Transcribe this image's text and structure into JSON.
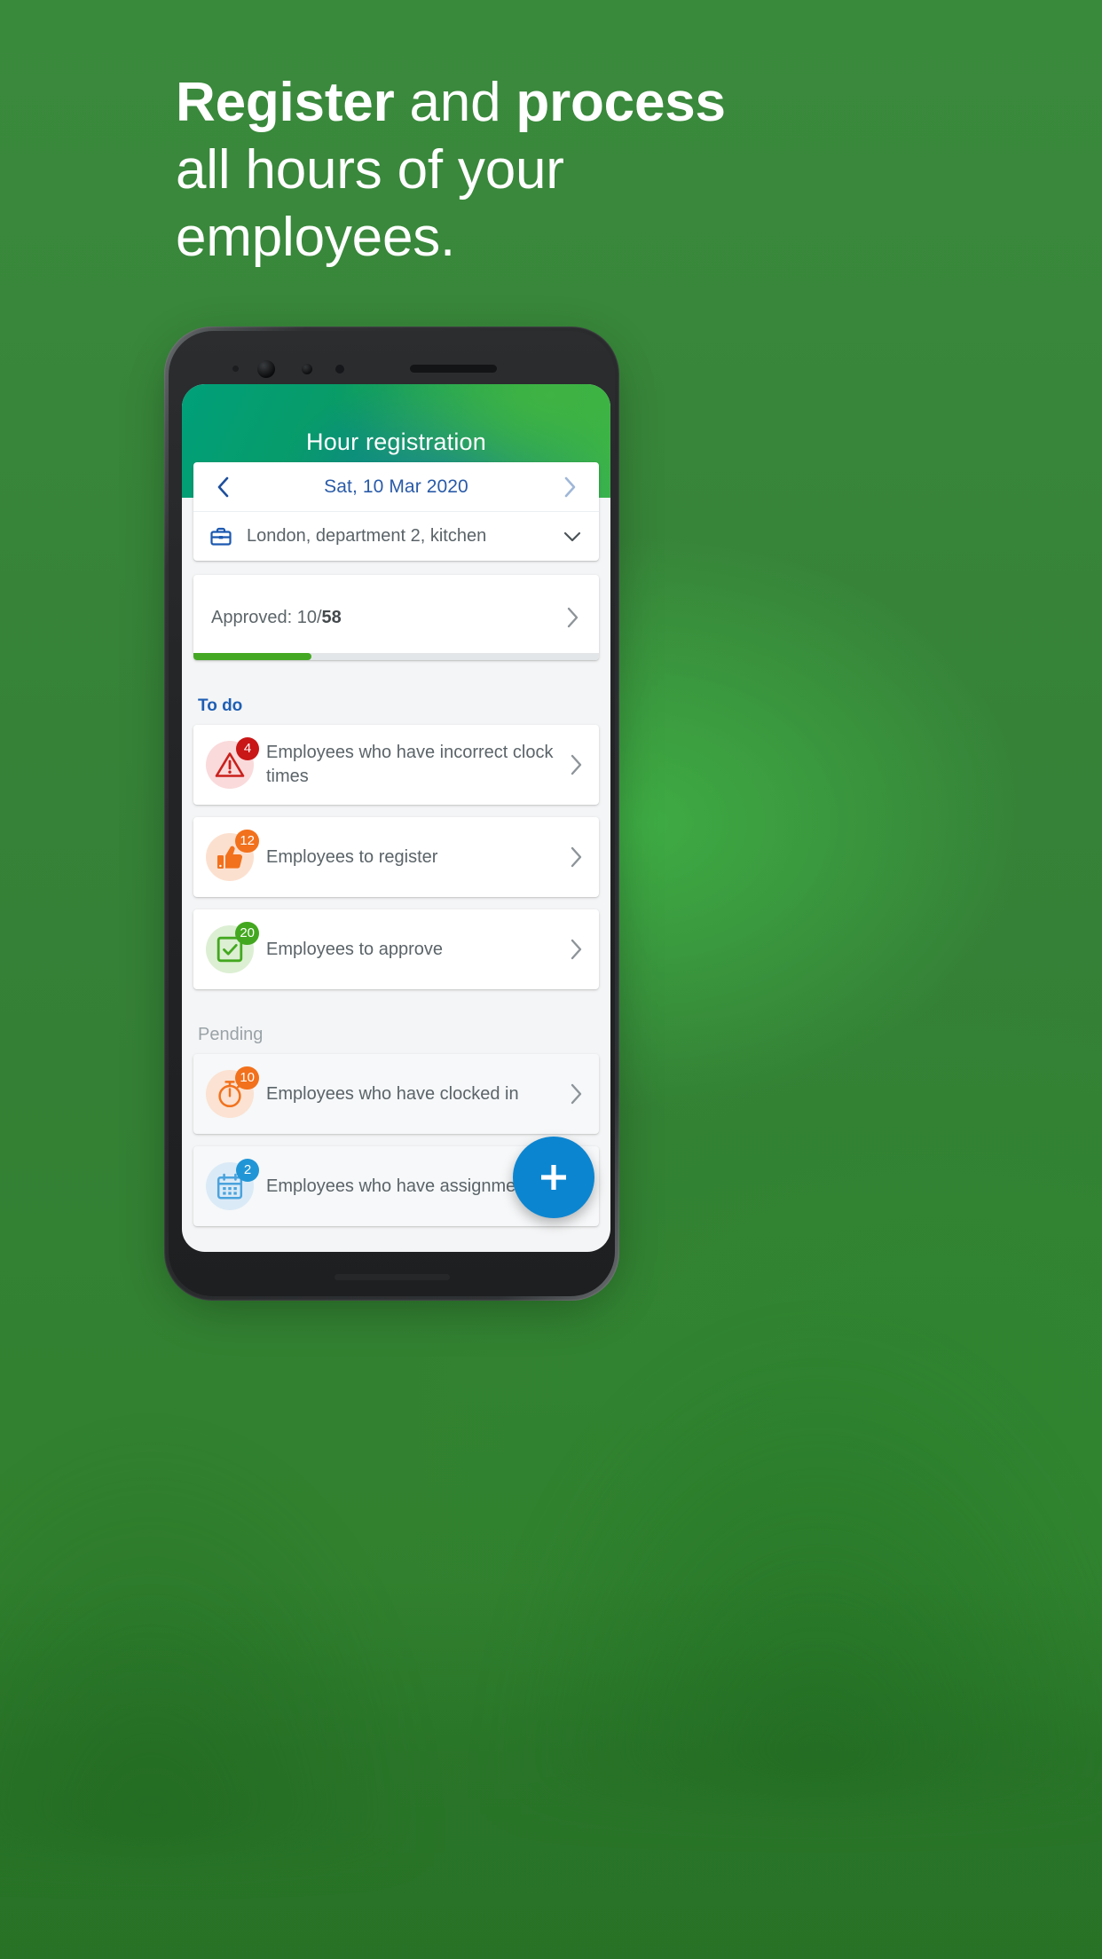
{
  "headline": {
    "part1": "Register",
    "part2": " and ",
    "part3": "process",
    "line2": "all hours of your",
    "line3": "employees."
  },
  "app": {
    "title": "Hour registration",
    "date": {
      "label": "Sat, 10 Mar 2020",
      "prev_icon": "chevron-left-icon",
      "next_icon": "chevron-right-icon"
    },
    "location": {
      "text": "London, department 2, kitchen",
      "icon": "briefcase-icon",
      "caret_icon": "chevron-down-icon"
    },
    "approved": {
      "prefix": "Approved: 10/",
      "total": "58",
      "progress_percent": 29,
      "arrow_icon": "chevron-right-icon"
    },
    "sections": [
      {
        "title": "To do",
        "title_color": "#1f5fb4",
        "items": [
          {
            "label": "Employees who have incorrect clock times",
            "badge": "4",
            "badge_color": "#c91616",
            "icon": "warning-triangle-icon",
            "icon_color": "#c9201c",
            "icon_bg": "#fadadb",
            "muted": false,
            "arrow_icon": "chevron-right-icon"
          },
          {
            "label": "Employees to register",
            "badge": "12",
            "badge_color": "#f2711c",
            "icon": "thumbs-up-icon",
            "icon_color": "#f2711c",
            "icon_bg": "#fce0cf",
            "muted": false,
            "arrow_icon": "chevron-right-icon"
          },
          {
            "label": "Employees to approve",
            "badge": "20",
            "badge_color": "#43a81f",
            "icon": "check-square-icon",
            "icon_color": "#43a81f",
            "icon_bg": "#dcefd3",
            "muted": false,
            "arrow_icon": "chevron-right-icon"
          }
        ]
      },
      {
        "title": "Pending",
        "title_color": "#9aa3a8",
        "items": [
          {
            "label": "Employees who have clocked in",
            "badge": "10",
            "badge_color": "#f2711c",
            "icon": "stopwatch-icon",
            "icon_color": "#f2711c",
            "icon_bg": "#fbe2d2",
            "muted": true,
            "arrow_icon": "chevron-right-icon"
          },
          {
            "label": "Employees who have assignments",
            "badge": "2",
            "badge_color": "#2196d6",
            "icon": "calendar-icon",
            "icon_color": "#4aa3dd",
            "icon_bg": "#dbeaf7",
            "muted": true,
            "arrow_icon": "chevron-right-icon"
          }
        ]
      }
    ],
    "fab": {
      "icon": "plus-icon",
      "color": "#0c85d0"
    }
  }
}
